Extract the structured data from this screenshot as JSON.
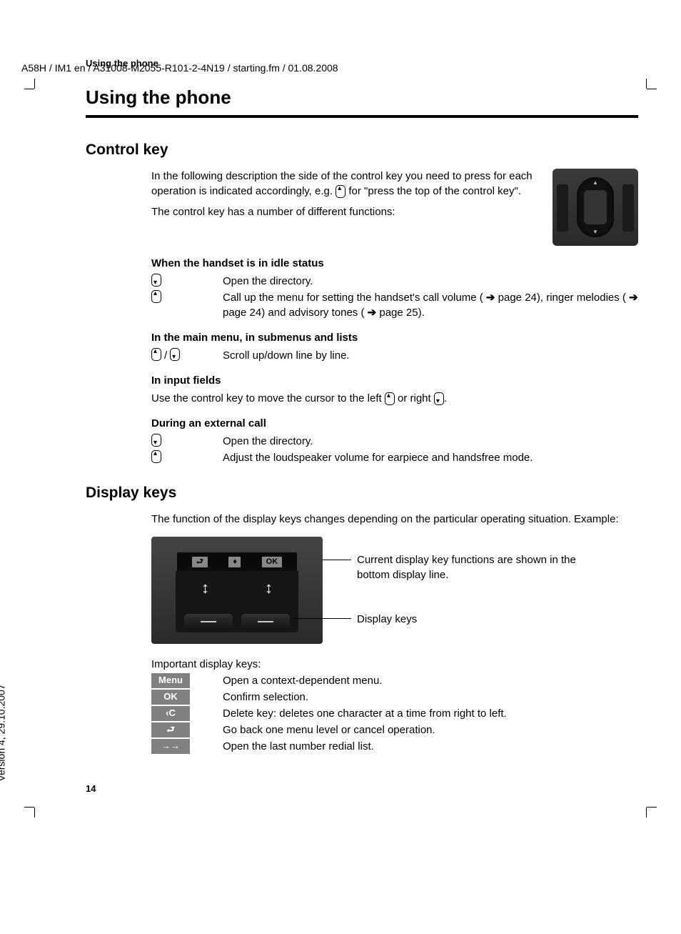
{
  "meta": {
    "header": "A58H / IM1 en / A31008-M2055-R101-2-4N19 / starting.fm / 01.08.2008",
    "running_head": "Using the phone",
    "page_number": "14",
    "version_text": "Version 4, 29.10.2007"
  },
  "title": "Using the phone",
  "control_key": {
    "heading": "Control key",
    "intro_1": "In the following description the side of the control key you need to press for each operation is indicated accordingly, e.g. ",
    "intro_2": " for \"press the top of the control key\".",
    "intro_3": "The control key has a number of different functions:",
    "sect_idle": "When the handset is in idle status",
    "idle_row1": "Open the directory.",
    "idle_row2_a": "Call up the menu for setting the handset's call volume ( ",
    "idle_row2_b": " page 24), ringer melodies ( ",
    "idle_row2_c": " page 24) and advisory tones ( ",
    "idle_row2_d": " page 25).",
    "sect_menu": "In the main menu, in submenus and lists",
    "menu_row1": "Scroll up/down line by line.",
    "sect_input": "In input fields",
    "input_text_a": "Use the control key to move the cursor to the left ",
    "input_text_b": " or right ",
    "input_text_c": ".",
    "sect_call": "During an external call",
    "call_row1": "Open the directory.",
    "call_row2": "Adjust the loudspeaker volume for earpiece and handsfree mode.",
    "slash": " / "
  },
  "display_keys": {
    "heading": "Display keys",
    "intro": "The function of the display keys changes depending on the particular operating situation. Example:",
    "figure": {
      "ok_label": "OK",
      "callout1": "Current display key functions are shown in the bottom display line.",
      "callout2": "Display keys"
    },
    "important_label": "Important display keys:",
    "keys": {
      "menu_label": "Menu",
      "menu_desc": "Open a context-dependent menu.",
      "ok_label": "OK",
      "ok_desc": "Confirm selection.",
      "del_label": "‹C",
      "del_desc": "Delete key: deletes one character at a time from right to left.",
      "back_label": "⮐",
      "back_desc": "Go back one menu level or cancel operation.",
      "redial_label": "→→",
      "redial_desc": "Open the last number redial list."
    }
  }
}
